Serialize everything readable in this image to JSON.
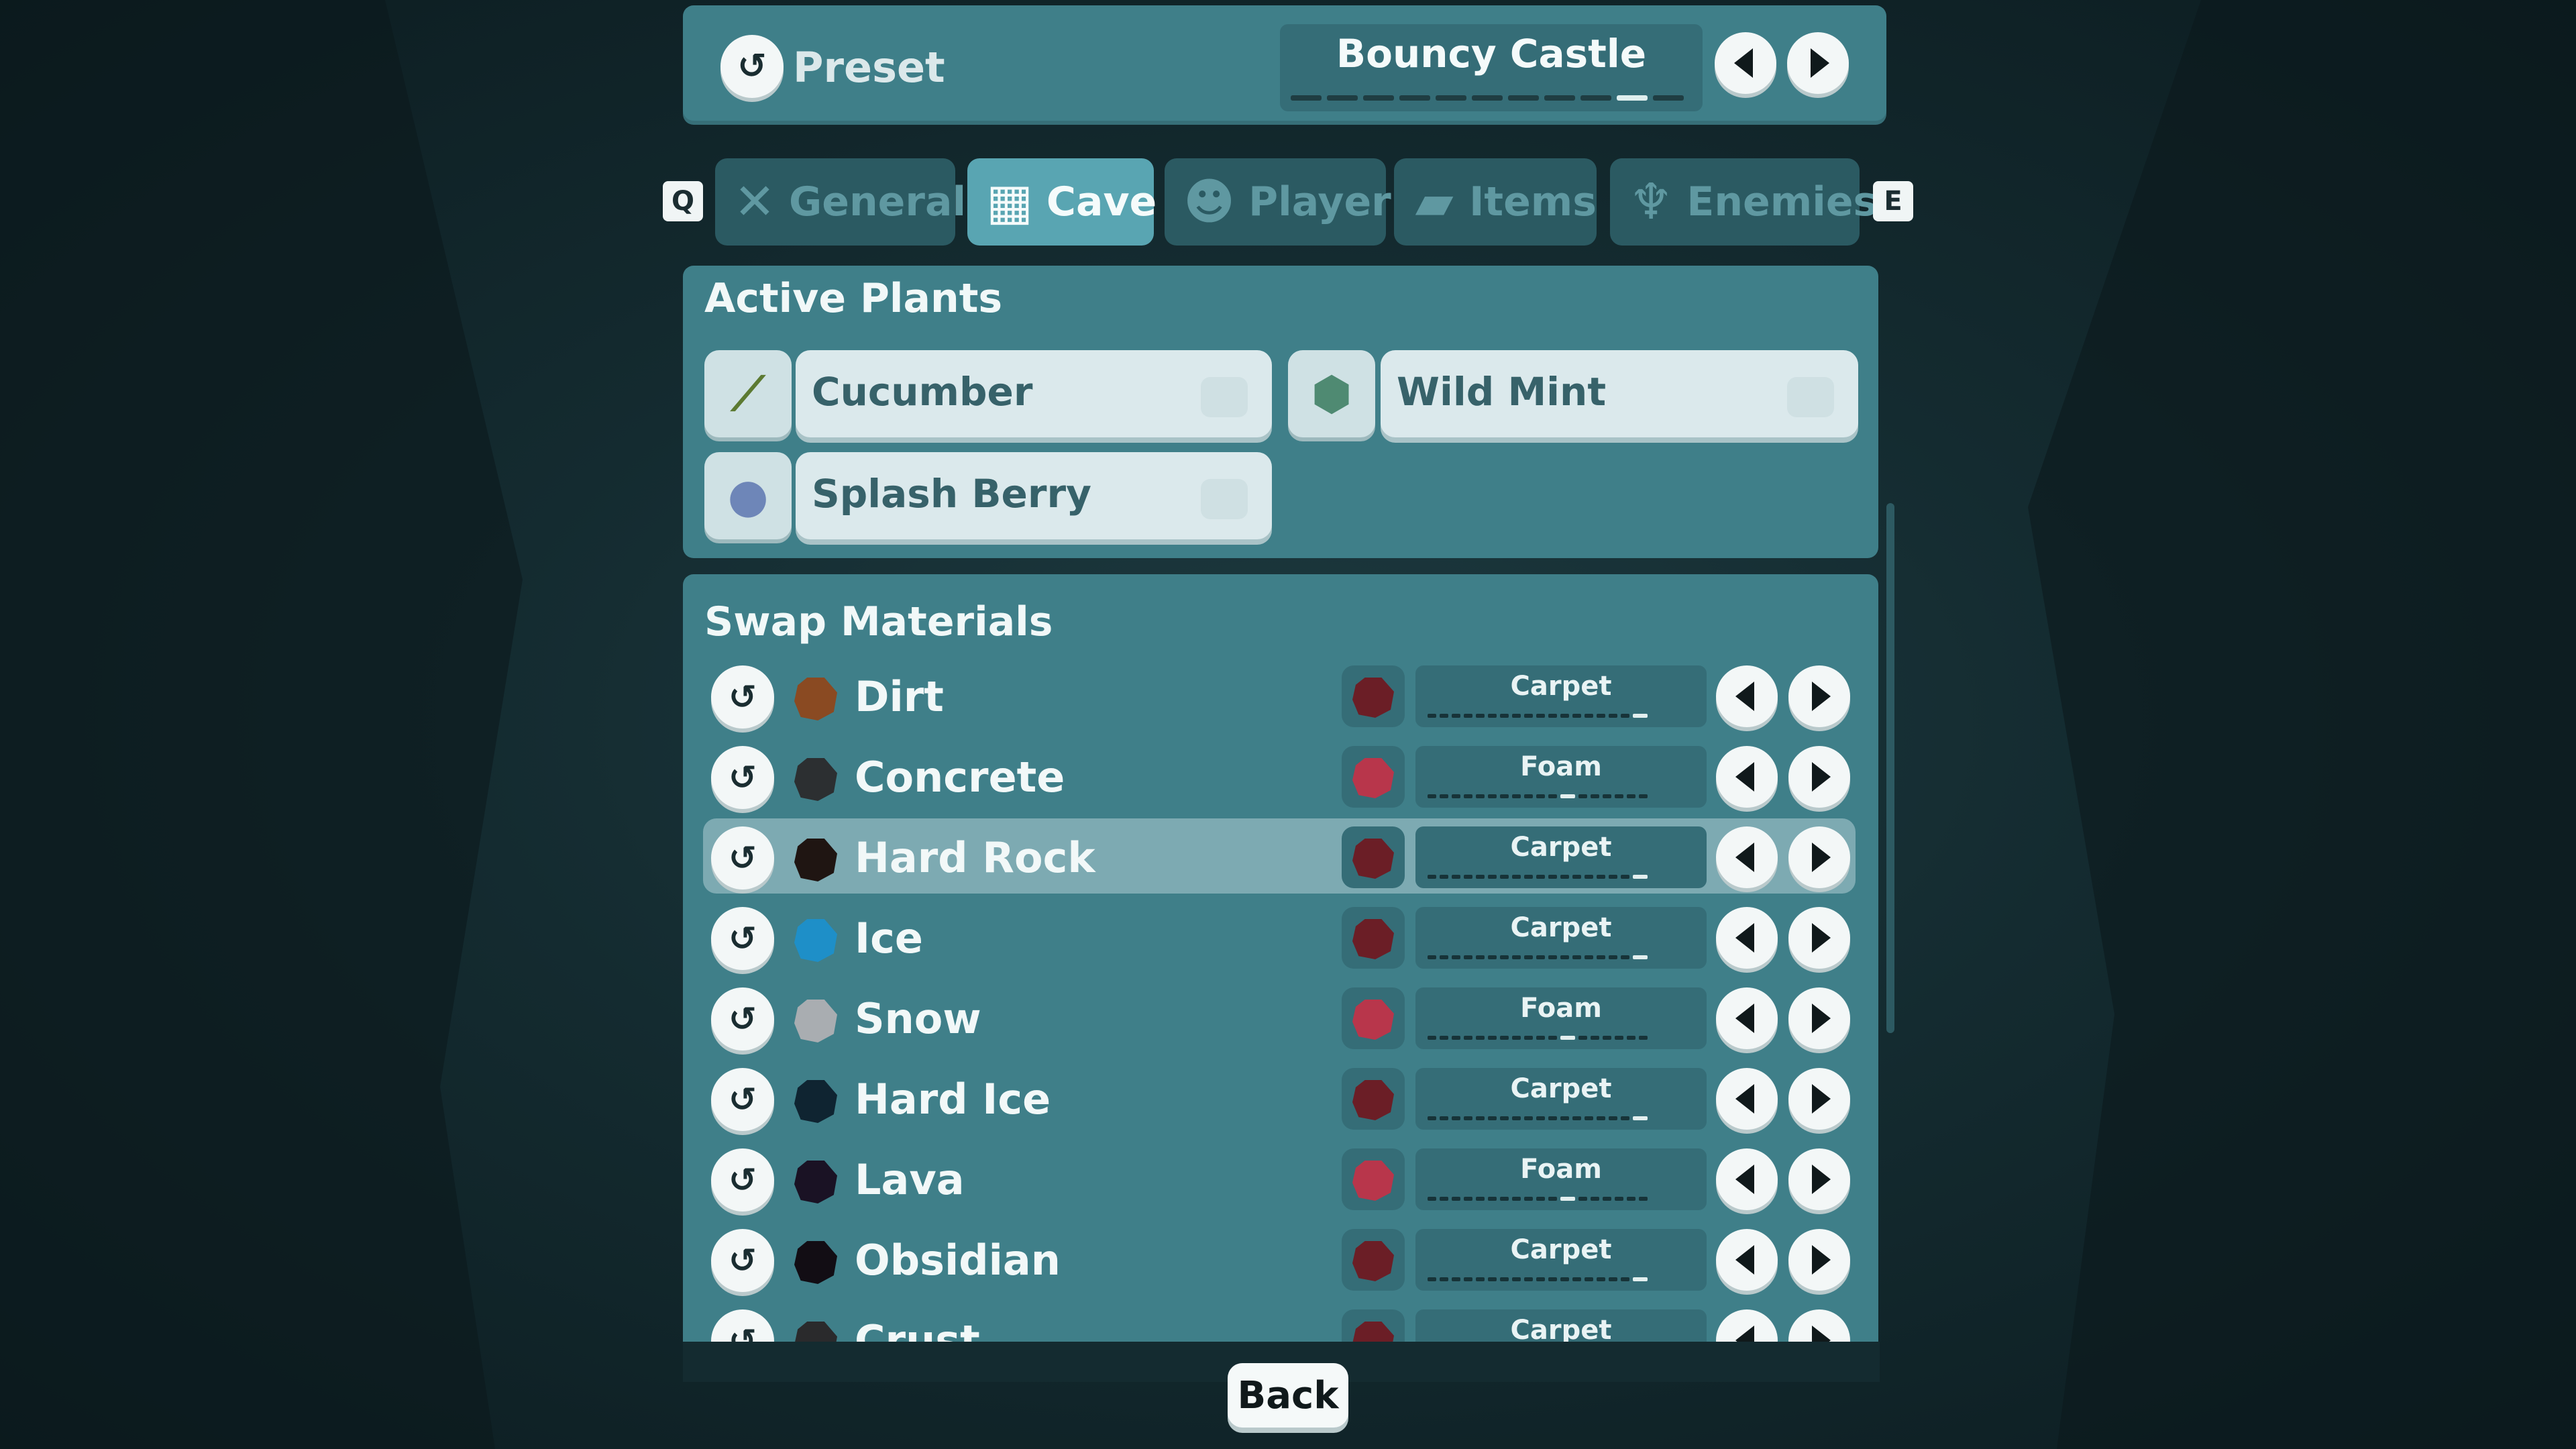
{
  "colors": {
    "panel": "#3f7f89",
    "tab_active": "#59a5b2",
    "tab_inactive": "#2b5a62",
    "button_white": "#f3f7f7"
  },
  "preset": {
    "label": "Preset",
    "name": "Bouncy Castle",
    "reset_icon": "reset-icon",
    "prev_icon": "arrow-left-icon",
    "next_icon": "arrow-right-icon"
  },
  "tabs": {
    "left_key": "Q",
    "right_key": "E",
    "items": [
      {
        "label": "General",
        "icon": "tools-icon",
        "active": false
      },
      {
        "label": "Cave",
        "icon": "cave-icon",
        "active": true
      },
      {
        "label": "Player",
        "icon": "player-icon",
        "active": false
      },
      {
        "label": "Items",
        "icon": "items-icon",
        "active": false
      },
      {
        "label": "Enemies",
        "icon": "enemies-icon",
        "active": false
      }
    ]
  },
  "active_plants": {
    "title": "Active Plants",
    "items": [
      {
        "name": "Cucumber",
        "icon": "cucumber-icon"
      },
      {
        "name": "Wild Mint",
        "icon": "wild-mint-icon"
      },
      {
        "name": "Splash Berry",
        "icon": "splash-berry-icon"
      }
    ]
  },
  "swap_materials": {
    "title": "Swap Materials",
    "rows": [
      {
        "name": "Dirt",
        "color": "#8a4a22",
        "swap": "Carpet",
        "swap_color": "#6b1e26",
        "selected": false
      },
      {
        "name": "Concrete",
        "color": "#2c2f31",
        "swap": "Foam",
        "swap_color": "#b8364b",
        "selected": false
      },
      {
        "name": "Hard Rock",
        "color": "#1f1512",
        "swap": "Carpet",
        "swap_color": "#6b1e26",
        "selected": true
      },
      {
        "name": "Ice",
        "color": "#1e8fc8",
        "swap": "Carpet",
        "swap_color": "#6b1e26",
        "selected": false
      },
      {
        "name": "Snow",
        "color": "#a9adb1",
        "swap": "Foam",
        "swap_color": "#b8364b",
        "selected": false
      },
      {
        "name": "Hard Ice",
        "color": "#0f2431",
        "swap": "Carpet",
        "swap_color": "#6b1e26",
        "selected": false
      },
      {
        "name": "Lava",
        "color": "#1a1224",
        "swap": "Foam",
        "swap_color": "#b8364b",
        "selected": false
      },
      {
        "name": "Obsidian",
        "color": "#120d14",
        "swap": "Carpet",
        "swap_color": "#6b1e26",
        "selected": false
      },
      {
        "name": "Crust",
        "color": "#2a2a2c",
        "swap": "Carpet",
        "swap_color": "#6b1e26",
        "selected": false
      }
    ]
  },
  "footer": {
    "back_label": "Back"
  }
}
